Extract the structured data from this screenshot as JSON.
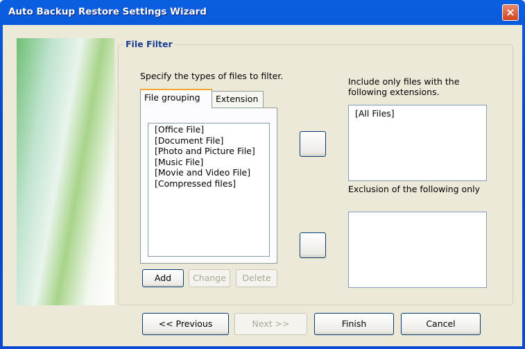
{
  "window": {
    "title": "Auto Backup Restore Settings Wizard",
    "close_icon": "×"
  },
  "group": {
    "legend": "File Filter",
    "instruction": "Specify the types of files to filter.",
    "tabs": [
      {
        "label": "File grouping",
        "active": true
      },
      {
        "label": "Extension",
        "active": false
      }
    ],
    "file_groups": [
      "[Office File]",
      "[Document File]",
      "[Photo and Picture File]",
      "[Music File]",
      "[Movie and Video File]",
      "[Compressed files]"
    ],
    "buttons": {
      "add": "Add",
      "change": "Change",
      "delete": "Delete"
    },
    "include_label": "Include only files with the following extensions.",
    "include_items": [
      "[All Files]"
    ],
    "exclude_label": "Exclusion of the following only",
    "exclude_items": []
  },
  "footer": {
    "previous": "<< Previous",
    "next": "Next >>",
    "finish": "Finish",
    "cancel": "Cancel"
  }
}
